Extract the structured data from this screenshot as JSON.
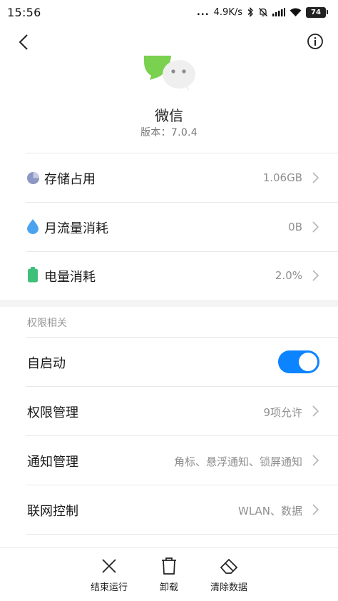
{
  "status_bar": {
    "time": "15:56",
    "dots": "...",
    "network_speed": "4.9K/s",
    "battery_level": "74",
    "icons": [
      "bluetooth-icon",
      "mute-icon",
      "signal-icon",
      "wifi-icon",
      "battery-icon"
    ]
  },
  "nav": {
    "back_icon": "chevron-left-icon",
    "info_icon": "info-icon"
  },
  "app": {
    "name": "微信",
    "version": "版本：7.0.4",
    "icon": "wechat-icon"
  },
  "usage": [
    {
      "label": "存储占用",
      "value": "1.06GB",
      "icon": "pie-chart-icon",
      "color": "#8c97c4"
    },
    {
      "label": "月流量消耗",
      "value": "0B",
      "icon": "water-drop-icon",
      "color": "#4ba3f0"
    },
    {
      "label": "电量消耗",
      "value": "2.0%",
      "icon": "battery-icon",
      "color": "#3fc07a"
    }
  ],
  "permissions": {
    "section_title": "权限相关",
    "autostart_label": "自启动",
    "autostart_enabled": true,
    "items": [
      {
        "label": "权限管理",
        "value": "9项允许"
      },
      {
        "label": "通知管理",
        "value": "角标、悬浮通知、锁屏通知"
      },
      {
        "label": "联网控制",
        "value": "WLAN、数据"
      }
    ]
  },
  "bottom_actions": [
    {
      "label": "结束运行",
      "icon": "close-icon"
    },
    {
      "label": "卸载",
      "icon": "trash-icon"
    },
    {
      "label": "清除数据",
      "icon": "eraser-icon"
    }
  ],
  "colors": {
    "accent": "#0d84ff",
    "text_primary": "#1a1a1a",
    "text_secondary": "#8f8f8f"
  }
}
